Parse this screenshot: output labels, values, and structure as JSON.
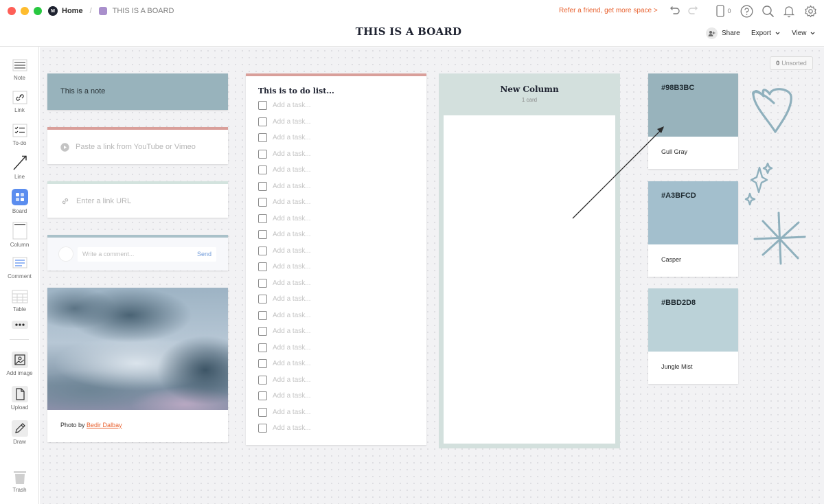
{
  "titlebar": {
    "home_label": "Home",
    "separator": "/",
    "board_crumb": "THIS IS A BOARD",
    "page_title": "THIS IS A BOARD",
    "refer_text": "Refer a friend, get more space >",
    "device_count": "0",
    "share_label": "Share",
    "export_label": "Export",
    "view_label": "View",
    "logo_glyph": "M"
  },
  "sidebar": {
    "tools": [
      {
        "label": "Note",
        "icon": "note-icon"
      },
      {
        "label": "Link",
        "icon": "link-icon"
      },
      {
        "label": "To-do",
        "icon": "todo-icon"
      },
      {
        "label": "Line",
        "icon": "line-icon"
      },
      {
        "label": "Board",
        "icon": "board-icon"
      },
      {
        "label": "Column",
        "icon": "column-icon"
      },
      {
        "label": "Comment",
        "icon": "comment-icon"
      },
      {
        "label": "Table",
        "icon": "table-icon"
      },
      {
        "label": "Add image",
        "icon": "image-icon"
      },
      {
        "label": "Upload",
        "icon": "upload-icon"
      },
      {
        "label": "Draw",
        "icon": "pencil-icon"
      },
      {
        "label": "Trash",
        "icon": "trash-icon"
      }
    ]
  },
  "canvas": {
    "unsorted_count": "0",
    "unsorted_label": "Unsorted",
    "note_text": "This is a note",
    "video_placeholder": "Paste a link from YouTube or Vimeo",
    "link_placeholder": "Enter a link URL",
    "comment_placeholder": "Write a comment...",
    "comment_send": "Send",
    "photo_caption_prefix": "Photo by",
    "photo_author": "Bedir Dalbay",
    "todo_title": "This is to do list...",
    "task_placeholder": "Add a task...",
    "task_count": 21,
    "column_title": "New Column",
    "column_count": "1 card"
  },
  "swatches": [
    {
      "hex": "#98B3BC",
      "name": "Gull Gray",
      "color": "#98B3BC"
    },
    {
      "hex": "#A3BFCD",
      "name": "Casper",
      "color": "#A3BFCD"
    },
    {
      "hex": "#BBD2D8",
      "name": "Jungle Mist",
      "color": "#BBD2D8"
    }
  ],
  "colors": {
    "accent_orange": "#e8612f",
    "note_bg": "#98b3bc",
    "column_bg": "#d3e0dd",
    "board_tile": "#5b8def",
    "doodle_stroke": "#8fb0bd"
  }
}
